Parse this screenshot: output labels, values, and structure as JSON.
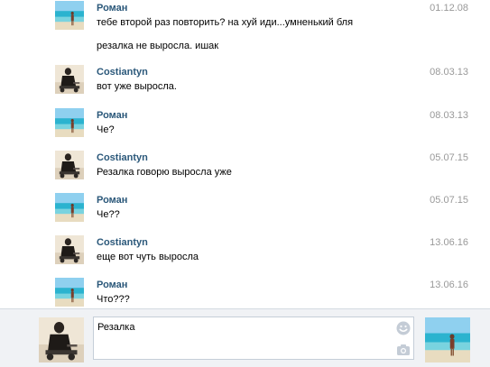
{
  "messages": [
    {
      "author": "Роман",
      "date": "01.12.08",
      "lines": [
        "тебе второй раз повторить? на хуй иди...умненький бля",
        "резалка не выросла. ишак"
      ],
      "avatar": "beach-photo"
    },
    {
      "author": "Costiantyn",
      "date": "08.03.13",
      "lines": [
        "вот уже выросла."
      ],
      "avatar": "desert-rider-photo"
    },
    {
      "author": "Роман",
      "date": "08.03.13",
      "lines": [
        "Че?"
      ],
      "avatar": "beach-photo"
    },
    {
      "author": "Costiantyn",
      "date": "05.07.15",
      "lines": [
        "Резалка говорю выросла уже"
      ],
      "avatar": "desert-rider-photo"
    },
    {
      "author": "Роман",
      "date": "05.07.15",
      "lines": [
        "Че??"
      ],
      "avatar": "beach-photo"
    },
    {
      "author": "Costiantyn",
      "date": "13.06.16",
      "lines": [
        "еще вот чуть выросла"
      ],
      "avatar": "desert-rider-photo"
    },
    {
      "author": "Роман",
      "date": "13.06.16",
      "lines": [
        "Что???"
      ],
      "avatar": "beach-photo"
    }
  ],
  "composer": {
    "input_value": "Резалка",
    "smile_icon": "smile-icon",
    "camera_icon": "camera-icon"
  },
  "colors": {
    "author": "#2b587a",
    "date": "#999999",
    "composer_bg": "#f0f2f5"
  }
}
